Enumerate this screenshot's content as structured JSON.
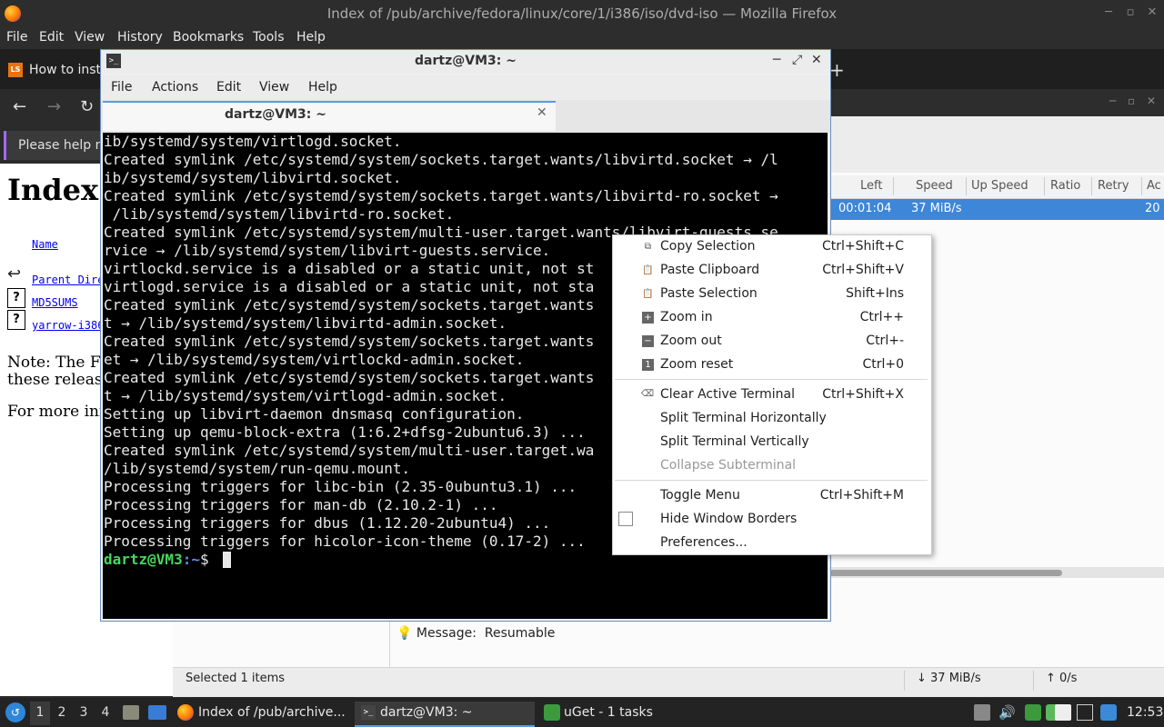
{
  "firefox": {
    "title": "Index of /pub/archive/fedora/linux/core/1/i386/iso/dvd-iso — Mozilla Firefox",
    "menu": [
      "File",
      "Edit",
      "View",
      "History",
      "Bookmarks",
      "Tools",
      "Help"
    ],
    "tab_favicon": "LS",
    "tab_label": "How to insta",
    "notification_text": "Please help m",
    "page": {
      "title": "Index",
      "col_name": "Name",
      "rows": [
        "Parent Dire",
        "MD5SUMS",
        "yarrow-i386"
      ],
      "note_1": "Note: The Fe",
      "note_2": "these release",
      "more": "For more inf"
    }
  },
  "uget": {
    "columns": [
      "Left",
      "Speed",
      "Up Speed",
      "Ratio",
      "Retry",
      "Ac"
    ],
    "row": {
      "left": "00:01:04",
      "speed": "37 MiB/s",
      "ac": "20"
    },
    "message_label": "Message:",
    "message_value": "Resumable",
    "status_selected": "Selected 1 items",
    "status_down": "↓  37 MiB/s",
    "status_up": "↑  0/s"
  },
  "terminal": {
    "title": "dartz@VM3: ~",
    "menu": [
      "File",
      "Actions",
      "Edit",
      "View",
      "Help"
    ],
    "tab_label": "dartz@VM3: ~",
    "lines": [
      "ib/systemd/system/virtlogd.socket.",
      "Created symlink /etc/systemd/system/sockets.target.wants/libvirtd.socket → /l",
      "ib/systemd/system/libvirtd.socket.",
      "Created symlink /etc/systemd/system/sockets.target.wants/libvirtd-ro.socket →",
      " /lib/systemd/system/libvirtd-ro.socket.",
      "Created symlink /etc/systemd/system/multi-user.target.wants/libvirt-guests.se",
      "rvice → /lib/systemd/system/libvirt-guests.service.",
      "virtlockd.service is a disabled or a static unit, not st",
      "virtlogd.service is a disabled or a static unit, not sta",
      "Created symlink /etc/systemd/system/sockets.target.wants",
      "t → /lib/systemd/system/libvirtd-admin.socket.",
      "Created symlink /etc/systemd/system/sockets.target.wants",
      "et → /lib/systemd/system/virtlockd-admin.socket.",
      "Created symlink /etc/systemd/system/sockets.target.wants",
      "t → /lib/systemd/system/virtlogd-admin.socket.",
      "Setting up libvirt-daemon dnsmasq configuration.",
      "Setting up qemu-block-extra (1:6.2+dfsg-2ubuntu6.3) ...",
      "Created symlink /etc/systemd/system/multi-user.target.wa",
      "/lib/systemd/system/run-qemu.mount.",
      "Processing triggers for libc-bin (2.35-0ubuntu3.1) ...",
      "Processing triggers for man-db (2.10.2-1) ...",
      "Processing triggers for dbus (1.12.20-2ubuntu4) ...",
      "Processing triggers for hicolor-icon-theme (0.17-2) ..."
    ],
    "prompt_user": "dartz@VM3",
    "prompt_sep": ":~",
    "prompt_symbol": "$"
  },
  "context_menu": {
    "copy_selection": {
      "label": "Copy Selection",
      "key": "Ctrl+Shift+C"
    },
    "paste_clipboard": {
      "label": "Paste Clipboard",
      "key": "Ctrl+Shift+V"
    },
    "paste_selection": {
      "label": "Paste Selection",
      "key": "Shift+Ins"
    },
    "zoom_in": {
      "label": "Zoom in",
      "key": "Ctrl++"
    },
    "zoom_out": {
      "label": "Zoom out",
      "key": "Ctrl+-"
    },
    "zoom_reset": {
      "label": "Zoom reset",
      "key": "Ctrl+0"
    },
    "clear_terminal": {
      "label": "Clear Active Terminal",
      "key": "Ctrl+Shift+X"
    },
    "split_h": {
      "label": "Split Terminal Horizontally"
    },
    "split_v": {
      "label": "Split Terminal Vertically"
    },
    "collapse": {
      "label": "Collapse Subterminal"
    },
    "toggle_menu": {
      "label": "Toggle Menu",
      "key": "Ctrl+Shift+M"
    },
    "hide_borders": {
      "label": "Hide Window Borders"
    },
    "preferences": {
      "label": "Preferences..."
    }
  },
  "taskbar": {
    "workspaces": [
      "1",
      "2",
      "3",
      "4"
    ],
    "tasks": [
      "Index of /pub/archive...",
      "dartz@VM3: ~",
      "uGet - 1 tasks"
    ],
    "clock": "12:53"
  }
}
